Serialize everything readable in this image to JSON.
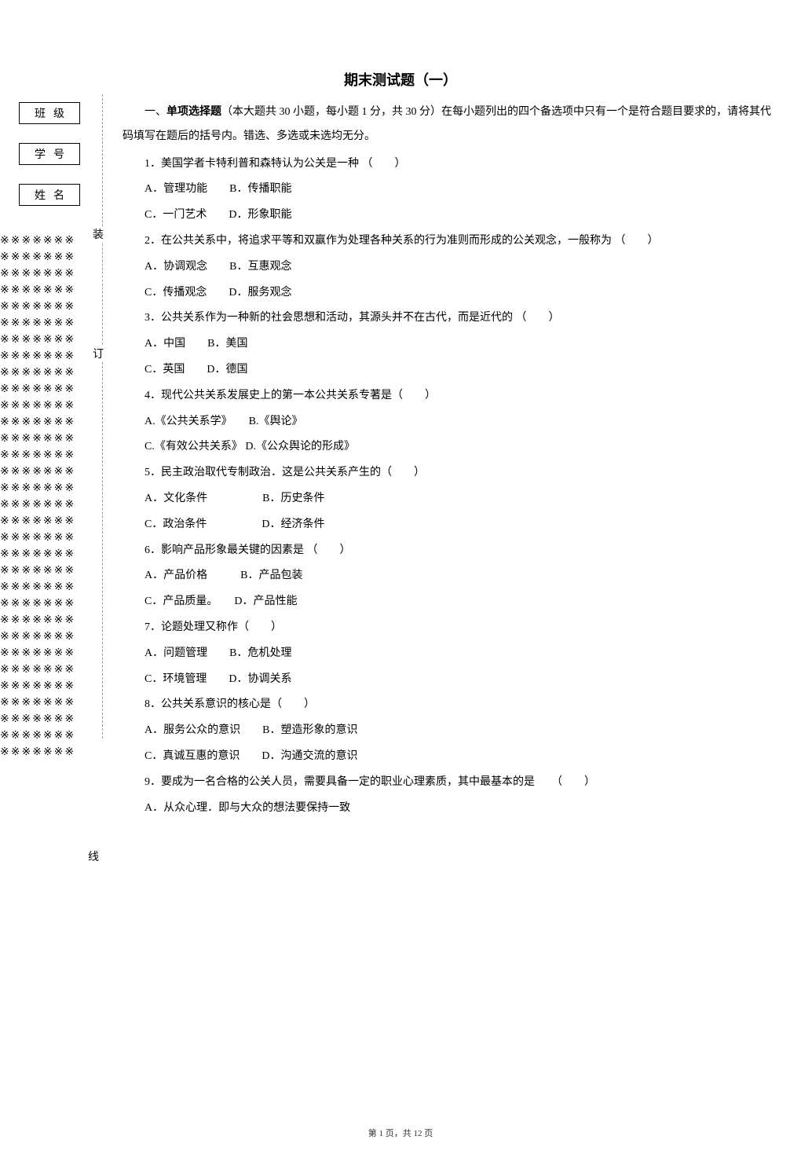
{
  "title": "期末测试题（一）",
  "sidebar": {
    "class_label": "班级",
    "student_id_label": "学号",
    "name_label": "姓名"
  },
  "binding": {
    "zhuang": "装",
    "ding": "订",
    "xian": "线",
    "pattern_char": "※"
  },
  "section": {
    "header_prefix": "一、",
    "header_bold": "单项选择题",
    "header_rest": "（本大题共 30 小题，每小题 1 分，共 30 分）在每小题列出的四个备选项中只有一个是符合题目要求的，请将其代码填写在题后的括号内。错选、多选或未选均无分。"
  },
  "questions": [
    {
      "q": "1．美国学者卡特利普和森特认为公关是一种 （　　）",
      "opts": [
        "A．管理功能　　B．传播职能",
        "C．一门艺术　　D．形象职能"
      ]
    },
    {
      "q": "2．在公共关系中，将追求平等和双赢作为处理各种关系的行为准则而形成的公关观念，一般称为 （　　）",
      "opts": [
        "A．协调观念　　B．互惠观念",
        "C．传播观念　　D．服务观念"
      ]
    },
    {
      "q": "3．公共关系作为一种新的社会思想和活动，其源头并不在古代，而是近代的 （　　）",
      "opts": [
        "A．中国　　B．美国",
        "C．英国　　D．德国"
      ]
    },
    {
      "q": "4．现代公共关系发展史上的第一本公共关系专著是（　　）",
      "opts": [
        "A.《公共关系学》　　B.《舆论》",
        "C.《有效公共关系》 D.《公众舆论的形成》"
      ]
    },
    {
      "q": "5．民主政治取代专制政治．这是公共关系产生的（　　）",
      "opts": [
        "A．文化条件　　　　　B．历史条件",
        "C．政治条件　　　　　D．经济条件"
      ]
    },
    {
      "q": "6．影响产品形象最关键的因素是 （　　）",
      "opts": [
        "A．产品价格　　　B．产品包装",
        "C．产品质量。　　D．产品性能"
      ]
    },
    {
      "q": "7．论题处理又称作（　　）",
      "opts": [
        "A．问题管理　　B．危机处理",
        "C．环境管理　　D．协调关系"
      ]
    },
    {
      "q": "8．公共关系意识的核心是（　　）",
      "opts": [
        "A．服务公众的意识　　B．塑造形象的意识",
        "C．真诚互惠的意识　　D．沟通交流的意识"
      ]
    },
    {
      "q": "9．要成为一名合格的公关人员，需要具备一定的职业心理素质，其中最基本的是　　（　　）",
      "opts": [
        "A．从众心理．即与大众的想法要保持一致"
      ]
    }
  ],
  "footer": "第 1 页，共 12 页"
}
